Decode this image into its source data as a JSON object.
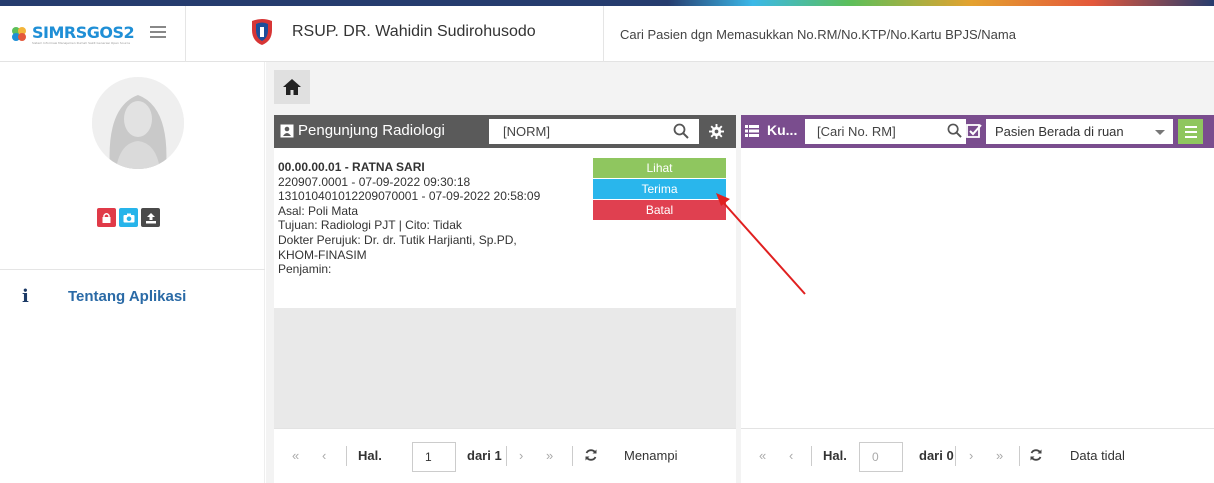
{
  "header": {
    "logo_text": "SIMRSGOS",
    "logo_num": "2",
    "logo_subtitle": "Sistem Informasi Manajemen Rumah Sakit Generasi Open Source",
    "hospital_name": "RSUP. DR. Wahidin Sudirohusodo",
    "search_hint": "Cari Pasien dgn Memasukkan No.RM/No.KTP/No.Kartu BPJS/Nama"
  },
  "sidebar": {
    "items": [
      {
        "label": "Tentang Aplikasi",
        "icon": "info-icon"
      }
    ]
  },
  "left_panel": {
    "title": "Pengunjung Radiologi",
    "search_placeholder": "[NORM]",
    "record": {
      "name": "00.00.00.01 - RATNA SARI",
      "visit": "220907.0001 - 07-09-2022 09:30:18",
      "reg": "131010401012209070001 - 07-09-2022 20:58:09",
      "asal": "Asal: Poli Mata",
      "tujuan": "Tujuan: Radiologi PJT | Cito: Tidak",
      "dokter1": "Dokter Perujuk: Dr. dr. Tutik Harjianti, Sp.PD,",
      "dokter2": "KHOM-FINASIM",
      "penjamin": "Penjamin:"
    },
    "buttons": {
      "lihat": "Lihat",
      "terima": "Terima",
      "batal": "Batal"
    },
    "pager": {
      "hal": "Hal.",
      "page": "1",
      "dari": "dari 1",
      "status": "Menampi"
    }
  },
  "right_panel": {
    "title": "Ku...",
    "search_placeholder": "[Cari No. RM]",
    "select_value": "Pasien Berada di ruan",
    "pager": {
      "hal": "Hal.",
      "page": "0",
      "dari": "dari 0",
      "status": "Data tidal"
    }
  },
  "colors": {
    "left_header": "#5a5a5a",
    "right_header": "#7a4d8e",
    "btn_green": "#8fc65f",
    "btn_blue": "#29b6ec",
    "btn_red": "#e04050",
    "annotation_arrow": "#e02020"
  }
}
